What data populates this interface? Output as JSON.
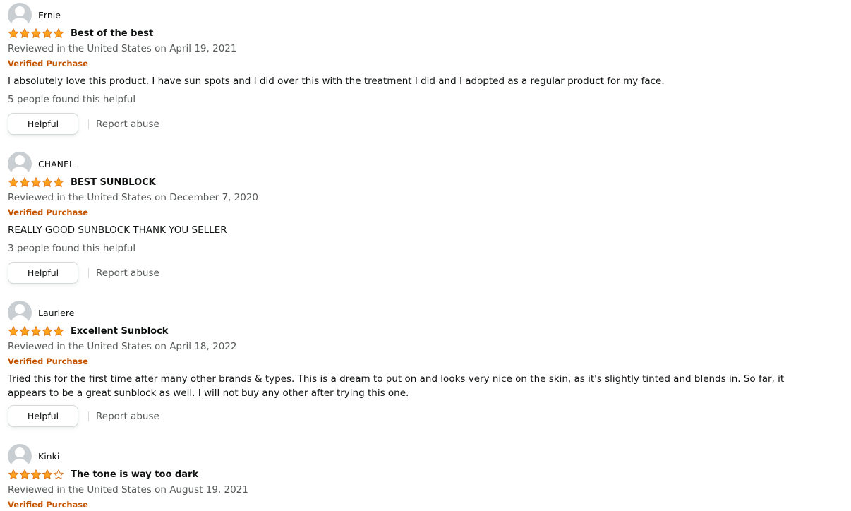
{
  "colors": {
    "star": "#ffa41c",
    "star_outline": "#de7921",
    "verified": "#c45500",
    "secondary_text": "#565959"
  },
  "reviews": [
    {
      "author": "Ernie",
      "rating": 5,
      "rating_out_of": 5,
      "title": "Best of the best",
      "date": "Reviewed in the United States on April 19, 2021",
      "verified": "Verified Purchase",
      "body": "I absolutely love this product. I have sun spots and I did over this with the treatment I did and I adopted as a regular product for my face.",
      "helpful_count": "5 people found this helpful",
      "helpful_label": "Helpful",
      "report_label": "Report abuse"
    },
    {
      "author": "CHANEL",
      "rating": 5,
      "rating_out_of": 5,
      "title": "BEST SUNBLOCK",
      "date": "Reviewed in the United States on December 7, 2020",
      "verified": "Verified Purchase",
      "body": "REALLY GOOD SUNBLOCK THANK YOU SELLER",
      "helpful_count": "3 people found this helpful",
      "helpful_label": "Helpful",
      "report_label": "Report abuse"
    },
    {
      "author": "Lauriere",
      "rating": 5,
      "rating_out_of": 5,
      "title": "Excellent Sunblock",
      "date": "Reviewed in the United States on April 18, 2022",
      "verified": "Verified Purchase",
      "body": "Tried this for the first time after many other brands & types. This is a dream to put on and looks very nice on the skin, as it's slightly tinted and blends in. So far, it appears to be a great sunblock as well. I will not buy any other after trying this one.",
      "helpful_label": "Helpful",
      "report_label": "Report abuse"
    },
    {
      "author": "Kinki",
      "rating": 4,
      "rating_out_of": 5,
      "title": "The tone is way too dark",
      "date": "Reviewed in the United States on August 19, 2021",
      "verified": "Verified Purchase"
    }
  ]
}
